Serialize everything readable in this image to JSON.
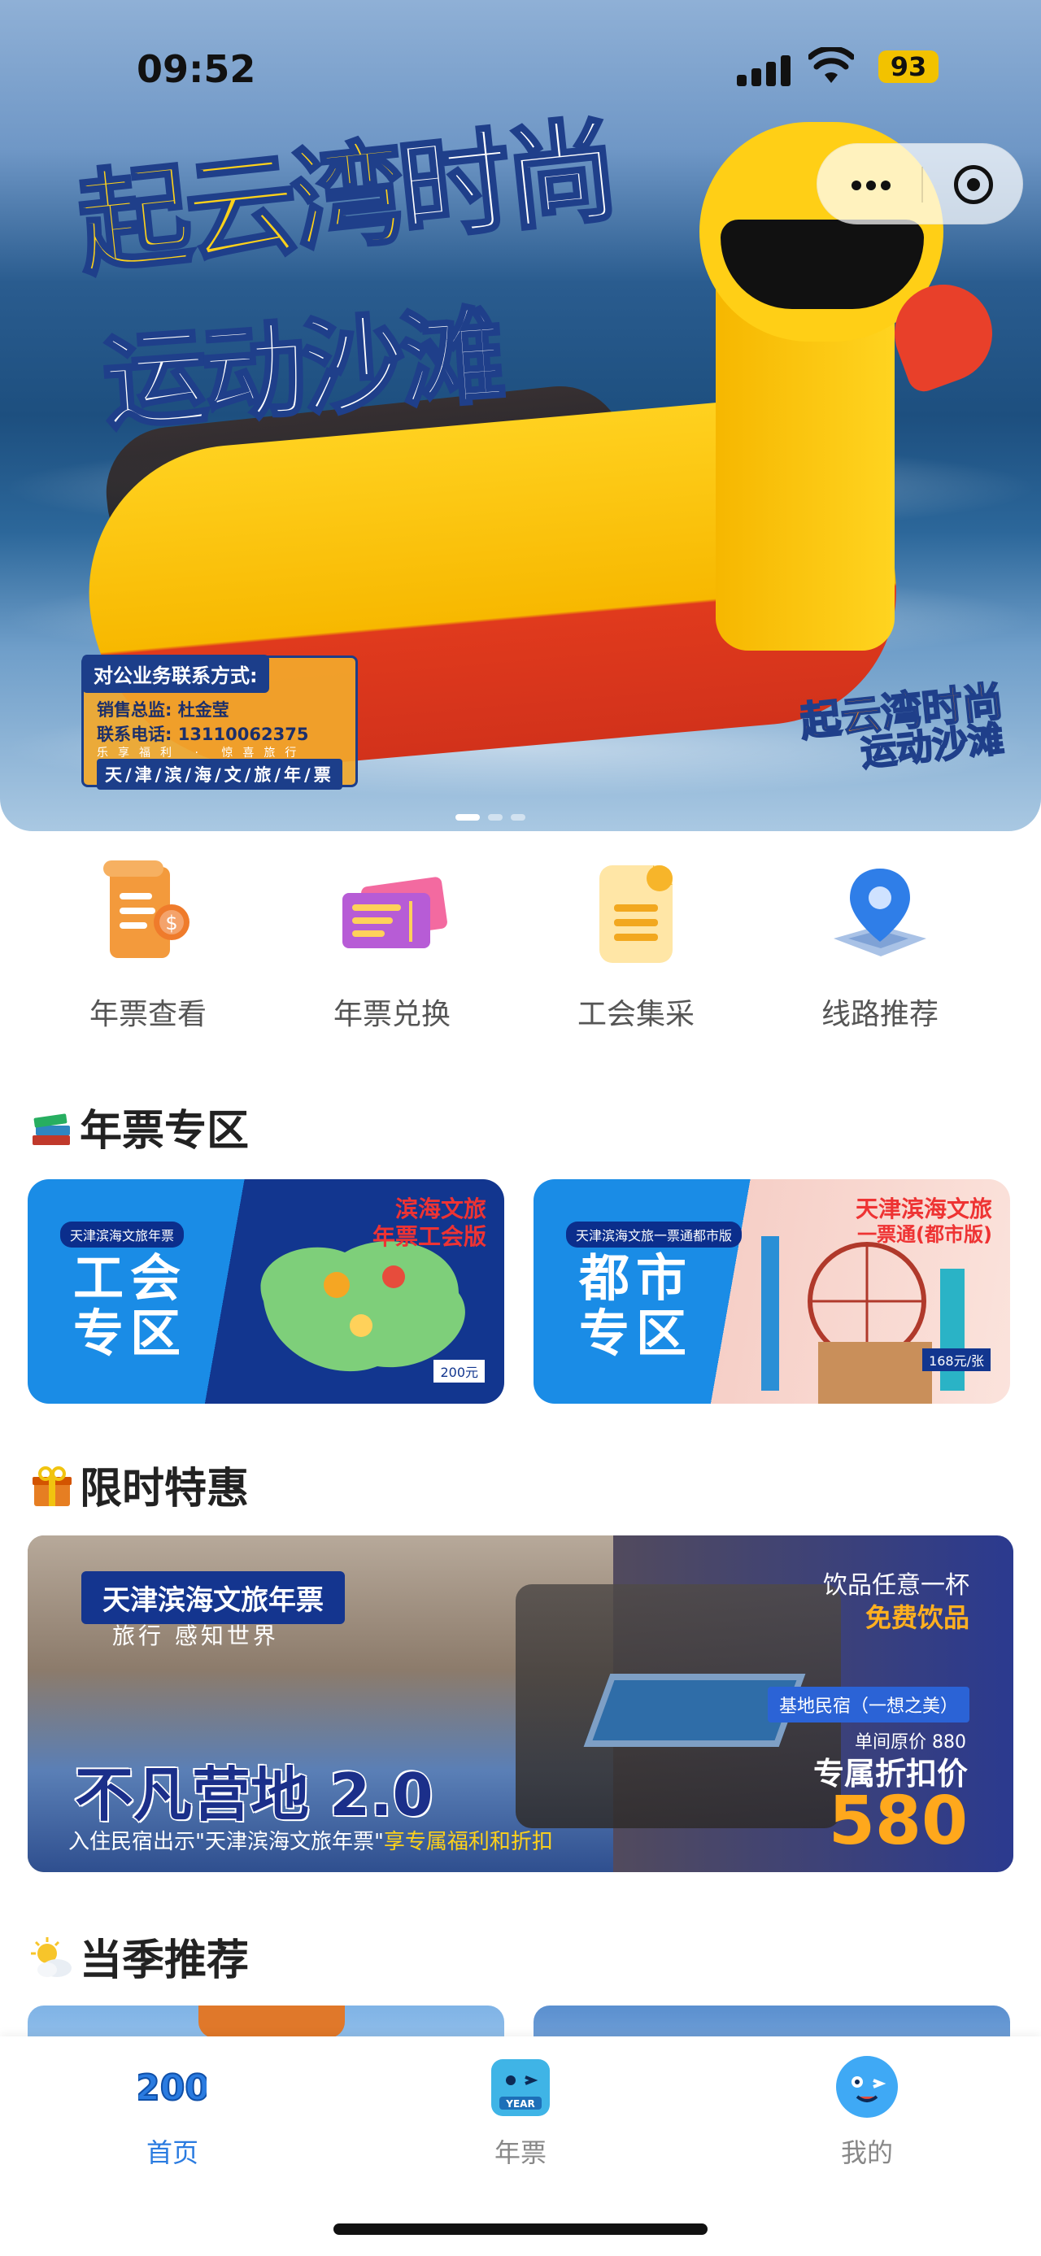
{
  "status_bar": {
    "time": "09:52",
    "battery": "93"
  },
  "hero": {
    "title_line1_a": "起云湾",
    "title_line1_b": "时尚",
    "title_line2": "运动沙滩",
    "contact_header": "对公业务联系方式:",
    "contact_manager": "销售总监: 杜金莹",
    "contact_phone": "联系电话: 13110062375",
    "contact_slogan": "乐享福利 · 惊喜旅行",
    "contact_brand": "天/津/滨/海/文/旅/年/票",
    "logo_a": "起云湾时尚",
    "logo_b": "运动沙滩"
  },
  "quick_nav": [
    {
      "label": "年票查看"
    },
    {
      "label": "年票兑换"
    },
    {
      "label": "工会集采"
    },
    {
      "label": "线路推荐"
    }
  ],
  "sections": {
    "annual_zone": "年票专区",
    "limited_offer": "限时特惠",
    "seasonal": "当季推荐"
  },
  "zones": [
    {
      "tag": "天津滨海文旅年票",
      "title_l1": "工会",
      "title_l2": "专区",
      "edition_l1": "滨海文旅",
      "edition_l2": "年票工会版",
      "price": "200元"
    },
    {
      "tag": "天津滨海文旅一票通都市版",
      "title_l1": "都市",
      "title_l2": "专区",
      "edition_l1": "天津滨海文旅",
      "edition_l2": "一票通(都市版)",
      "price": "168元/张"
    }
  ],
  "promo": {
    "badge": "天津滨海文旅年票",
    "slogan": "旅行   感知世界",
    "name": "不凡营地 2.0",
    "tip_a": "入住民宿出示\"天津滨海文旅年票\"",
    "tip_b": "享专属福利和折扣",
    "drink_a": "饮品任意一杯",
    "drink_b": "免费饮品",
    "location": "基地民宿（一想之美）",
    "original_price": "单间原价 880",
    "discount_label": "专属折扣价",
    "discount_price": "580"
  },
  "tabbar": [
    {
      "label": "首页",
      "icon_text": "200",
      "active": true
    },
    {
      "label": "年票",
      "icon_text": "YEAR",
      "active": false
    },
    {
      "label": "我的",
      "active": false
    }
  ],
  "colors": {
    "accent": "#2a7be0",
    "brand_blue": "#14358f",
    "price_orange": "#ffa81c"
  }
}
